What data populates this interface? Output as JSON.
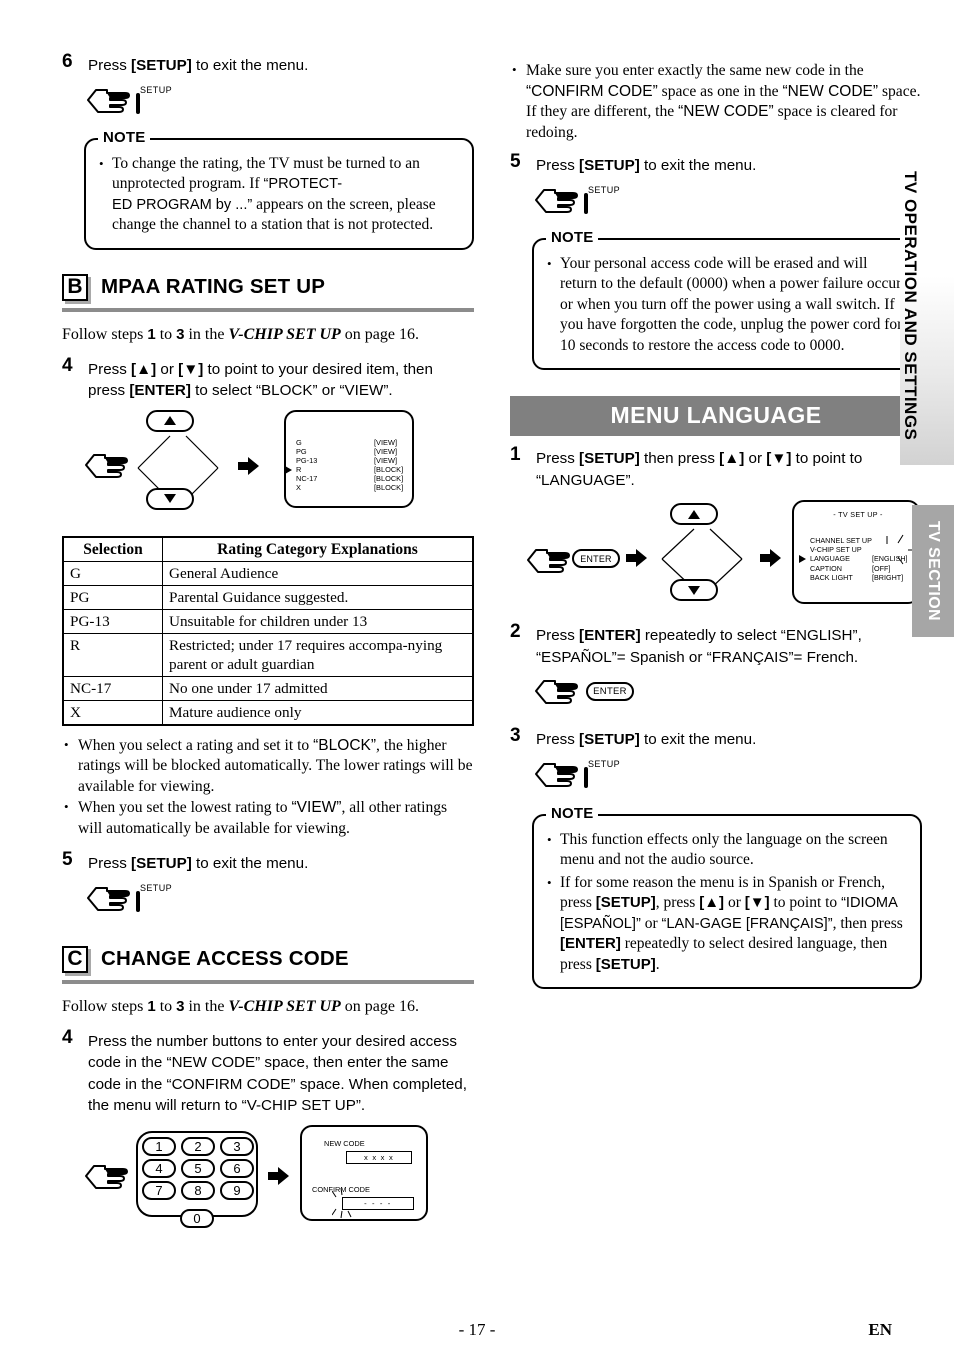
{
  "page": {
    "number": "- 17 -",
    "lang_code": "EN"
  },
  "side_tabs": {
    "operation": "TV OPERATION AND SETTINGS",
    "section": "TV SECTION"
  },
  "left_column": {
    "step6": {
      "num": "6",
      "text_before": "Press ",
      "key": "[SETUP]",
      "text_after": " to exit the menu.",
      "button_label": "SETUP"
    },
    "note1": {
      "title": "NOTE",
      "items": [
        "To change the rating, the TV must be turned to an unprotected program. If “PROTECTED PROGRAM by ...” appears on the screen, please change the channel to a station that is not protected."
      ]
    },
    "section_b": {
      "letter": "B",
      "title": "MPAA RATING SET UP",
      "follow": {
        "pre": "Follow steps ",
        "from": "1",
        "mid": " to ",
        "to": "3",
        "in": " in the ",
        "ref": "V-CHIP SET UP",
        "post": " on page 16."
      },
      "step4": {
        "num": "4",
        "text": "Press [▲] or [▼] to point to your desired item, then press [ENTER] to select “BLOCK” or “VIEW”."
      },
      "osd_vchip": {
        "rows": [
          {
            "label": "G",
            "value": "[VIEW]",
            "cursor": false
          },
          {
            "label": "PG",
            "value": "[VIEW]",
            "cursor": false
          },
          {
            "label": "PG-13",
            "value": "[VIEW]",
            "cursor": false
          },
          {
            "label": "R",
            "value": "[BLOCK]",
            "cursor": true
          },
          {
            "label": "NC-17",
            "value": "[BLOCK]",
            "cursor": false
          },
          {
            "label": "X",
            "value": "[BLOCK]",
            "cursor": false
          }
        ]
      },
      "table": {
        "headers": [
          "Selection",
          "Rating Category Explanations"
        ],
        "rows": [
          [
            "G",
            "General Audience"
          ],
          [
            "PG",
            "Parental Guidance suggested."
          ],
          [
            "PG-13",
            "Unsuitable for children under 13"
          ],
          [
            "R",
            "Restricted; under 17 requires accompa-nying parent or adult guardian"
          ],
          [
            "NC-17",
            "No one under 17 admitted"
          ],
          [
            "X",
            "Mature audience only"
          ]
        ]
      },
      "bullets": [
        "When you select a rating and set it to “BLOCK”, the higher ratings will be blocked automatically. The lower ratings will be available for viewing.",
        "When you set the lowest rating to “VIEW”, all other ratings will automatically be available for viewing."
      ],
      "step5": {
        "num": "5",
        "text": "Press [SETUP] to exit the menu.",
        "button_label": "SETUP"
      }
    },
    "section_c": {
      "letter": "C",
      "title": "CHANGE ACCESS CODE",
      "follow": {
        "pre": "Follow steps ",
        "from": "1",
        "mid": " to ",
        "to": "3",
        "in": " in the ",
        "ref": "V-CHIP SET UP",
        "post": " on page 16."
      },
      "step4": {
        "num": "4",
        "text": "Press the number buttons to enter your desired access code in the “NEW CODE” space, then enter the same code in the “CONFIRM CODE” space. When completed, the menu will return to “V-CHIP SET UP”."
      },
      "keypad": {
        "keys": [
          "1",
          "2",
          "3",
          "4",
          "5",
          "6",
          "7",
          "8",
          "9",
          "0"
        ]
      },
      "osd_code": {
        "new_code_label": "NEW CODE",
        "new_code_value": "x x x x",
        "confirm_code_label": "CONFIRM CODE",
        "confirm_code_value": "- - - -"
      }
    }
  },
  "right_column": {
    "top_bullets": [
      "Make sure you enter exactly the same new code in the “CONFIRM CODE” space as one in the “NEW CODE” space. If they are different, the “NEW CODE” space is cleared for redoing."
    ],
    "step5": {
      "num": "5",
      "text": "Press [SETUP] to exit the menu.",
      "button_label": "SETUP"
    },
    "note_access": {
      "title": "NOTE",
      "items": [
        "Your personal access code will be erased and will return to the default (0000) when a power failure occurs or when you turn off the power using a wall switch. If you have forgotten the code, unplug the power cord for 10 seconds to restore the access code to 0000."
      ]
    },
    "menu_language": {
      "banner": "MENU LANGUAGE",
      "step1": {
        "num": "1",
        "text": "Press [SETUP] then press [▲] or [▼] to point to “LANGUAGE”.",
        "enter_label": "ENTER"
      },
      "osd_tvsetup": {
        "title": "- TV SET UP -",
        "rows": [
          {
            "label": "CHANNEL SET UP",
            "value": "",
            "cursor": false
          },
          {
            "label": "V-CHIP SET UP",
            "value": "",
            "cursor": false
          },
          {
            "label": "LANGUAGE",
            "value": "[ENGLISH]",
            "cursor": true
          },
          {
            "label": "CAPTION",
            "value": "[OFF]",
            "cursor": false
          },
          {
            "label": "BACK LIGHT",
            "value": "[BRIGHT]",
            "cursor": false
          }
        ]
      },
      "step2": {
        "num": "2",
        "text": "Press [ENTER] repeatedly to select “ENGLISH”, “ESPAÑOL”= Spanish or “FRANÇAIS”= French.",
        "enter_label": "ENTER"
      },
      "step3": {
        "num": "3",
        "text": "Press [SETUP] to exit the menu.",
        "button_label": "SETUP"
      },
      "note": {
        "title": "NOTE",
        "items": [
          "This function effects only the language on the screen menu and not the audio source.",
          "If for some reason the menu is in Spanish or French, press [SETUP], press [▲] or [▼] to point to “IDIOMA [ESPAÑOL]” or “LANGAGE [FRANÇAIS]”, then press [ENTER] repeatedly to select desired language, then press [SETUP]."
        ]
      }
    }
  }
}
